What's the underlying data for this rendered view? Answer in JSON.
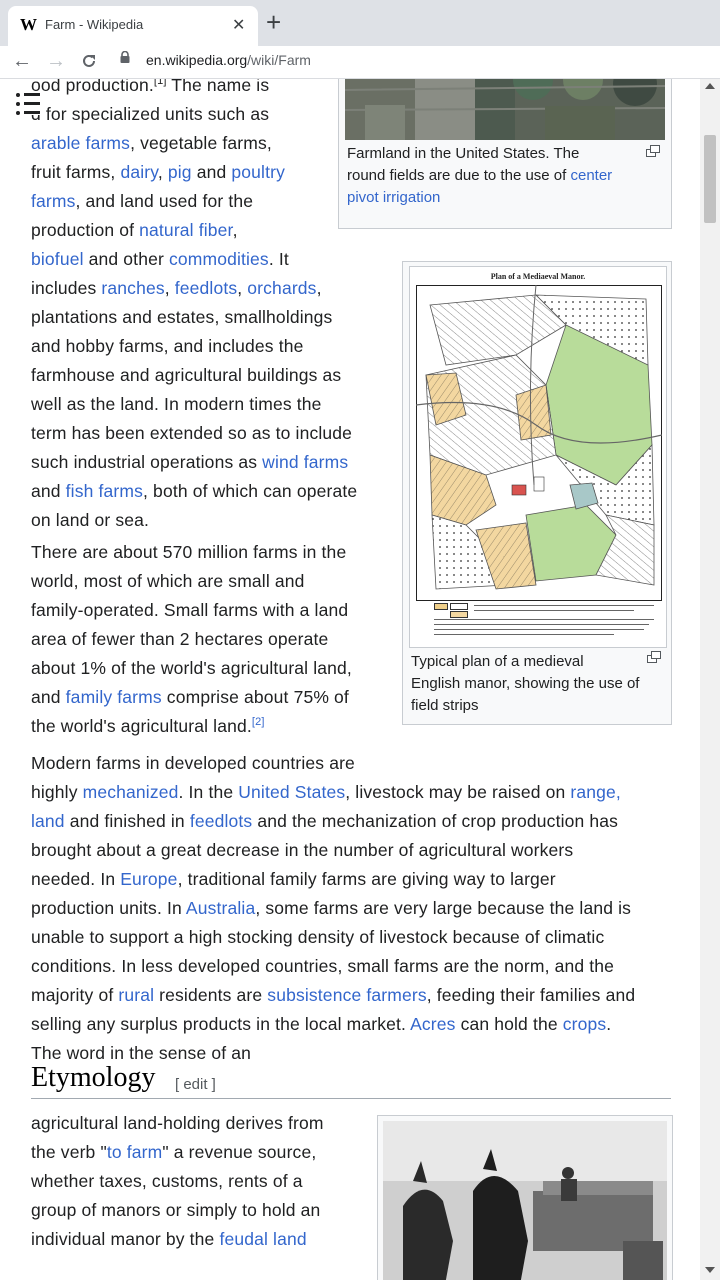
{
  "browser": {
    "tab_title": "Farm - Wikipedia",
    "tab_favicon": "W",
    "close_glyph": "✕",
    "new_tab_glyph": "+",
    "url_domain": "en.wikipedia.org",
    "url_path": "/wiki/Farm"
  },
  "article": {
    "lines": [
      [
        {
          "t": "ood production."
        },
        {
          "t": "[1]",
          "sup": true
        },
        {
          "t": " The name is"
        }
      ],
      [
        {
          "t": "d for specialized units such as"
        }
      ],
      [
        {
          "t": "arable farms",
          "link": true
        },
        {
          "t": ", vegetable farms,"
        }
      ],
      [
        {
          "t": "fruit farms, "
        },
        {
          "t": "dairy",
          "link": true
        },
        {
          "t": ", "
        },
        {
          "t": "pig",
          "link": true
        },
        {
          "t": " and "
        },
        {
          "t": "poultry",
          "link": true
        }
      ],
      [
        {
          "t": "farms",
          "link": true
        },
        {
          "t": ", and land used for the"
        }
      ],
      [
        {
          "t": "production of "
        },
        {
          "t": "natural fiber",
          "link": true
        },
        {
          "t": ","
        }
      ],
      [
        {
          "t": "biofuel",
          "link": true
        },
        {
          "t": " and other "
        },
        {
          "t": "commodities",
          "link": true
        },
        {
          "t": ". It"
        }
      ],
      [
        {
          "t": "includes "
        },
        {
          "t": "ranches",
          "link": true
        },
        {
          "t": ", "
        },
        {
          "t": "feedlots",
          "link": true
        },
        {
          "t": ", "
        },
        {
          "t": "orchards",
          "link": true
        },
        {
          "t": ","
        }
      ],
      [
        {
          "t": "plantations and estates, smallholdings"
        }
      ],
      [
        {
          "t": "and hobby farms, and includes the"
        }
      ],
      [
        {
          "t": "farmhouse and agricultural buildings as"
        }
      ],
      [
        {
          "t": "well as the land. In modern times the"
        }
      ],
      [
        {
          "t": "term has been extended so as to include"
        }
      ],
      [
        {
          "t": "such industrial operations as "
        },
        {
          "t": "wind farms",
          "link": true
        }
      ],
      [
        {
          "t": "and "
        },
        {
          "t": "fish farms",
          "link": true
        },
        {
          "t": ", both of which can operate"
        }
      ],
      [
        {
          "t": "on land or sea."
        }
      ],
      [
        {
          "t": "There are about 570 million farms in the"
        }
      ],
      [
        {
          "t": "world, most of which are small and"
        }
      ],
      [
        {
          "t": "family-operated. Small farms with a land"
        }
      ],
      [
        {
          "t": "area of fewer than 2 hectares operate"
        }
      ],
      [
        {
          "t": "about 1% of the world's agricultural land,"
        }
      ],
      [
        {
          "t": "and "
        },
        {
          "t": "family farms",
          "link": true
        },
        {
          "t": " comprise about 75% of"
        }
      ],
      [
        {
          "t": "the world's agricultural land."
        },
        {
          "t": "[2]",
          "sup": true,
          "link": true
        }
      ],
      [
        {
          "t": "Modern farms in developed countries are"
        }
      ],
      [
        {
          "t": "highly "
        },
        {
          "t": "mechanized",
          "link": true
        },
        {
          "t": ". In the "
        },
        {
          "t": "United States",
          "link": true
        },
        {
          "t": ", livestock may be raised on "
        },
        {
          "t": "range,",
          "link": true
        }
      ],
      [
        {
          "t": "land",
          "link": true
        },
        {
          "t": " and finished in "
        },
        {
          "t": "feedlots",
          "link": true
        },
        {
          "t": " and the mechanization of crop production has"
        }
      ],
      [
        {
          "t": "brought about a great decrease in the number of agricultural workers"
        }
      ],
      [
        {
          "t": "needed. In "
        },
        {
          "t": "Europe",
          "link": true
        },
        {
          "t": ", traditional family farms are giving way to larger"
        }
      ],
      [
        {
          "t": "production units. In "
        },
        {
          "t": "Australia",
          "link": true
        },
        {
          "t": ", some farms are very large because the land is"
        }
      ],
      [
        {
          "t": "unable to support a high stocking density of livestock because of climatic"
        }
      ],
      [
        {
          "t": "conditions. In less developed countries, small farms are the norm, and the"
        }
      ],
      [
        {
          "t": "majority of "
        },
        {
          "t": "rural",
          "link": true
        },
        {
          "t": " residents are "
        },
        {
          "t": "subsistence farmers",
          "link": true
        },
        {
          "t": ", feeding their families and"
        }
      ],
      [
        {
          "t": "selling any surplus products in the local market. "
        },
        {
          "t": "Acres",
          "link": true
        },
        {
          "t": " can hold the "
        },
        {
          "t": "crops",
          "link": true
        },
        {
          "t": "."
        }
      ],
      [
        {
          "t": "The word in the sense of an"
        }
      ],
      [
        {
          "t": "agricultural land-holding derives from"
        }
      ],
      [
        {
          "t": "the verb \""
        },
        {
          "t": "to farm",
          "link": true
        },
        {
          "t": "\" a revenue source,"
        }
      ],
      [
        {
          "t": "whether taxes, customs, rents of a"
        }
      ],
      [
        {
          "t": "group of manors or simply to hold an"
        }
      ],
      [
        {
          "t": "individual manor by the "
        },
        {
          "t": "feudal land",
          "link": true
        }
      ]
    ],
    "figure1": {
      "caption": [
        [
          {
            "t": "Farmland in the United States. The"
          }
        ],
        [
          {
            "t": "round fields are due to the use of "
          },
          {
            "t": "center",
            "link": true
          }
        ],
        [
          {
            "t": "pivot irrigation",
            "link": true
          }
        ]
      ]
    },
    "figure2": {
      "map_title": "Plan of a Mediaeval Manor.",
      "caption": [
        [
          {
            "t": "Typical plan of a medieval"
          }
        ],
        [
          {
            "t": "English manor, showing the use of"
          }
        ],
        [
          {
            "t": "field strips"
          }
        ]
      ]
    },
    "section_heading": "Etymology",
    "edit_label": "[ edit ]"
  }
}
